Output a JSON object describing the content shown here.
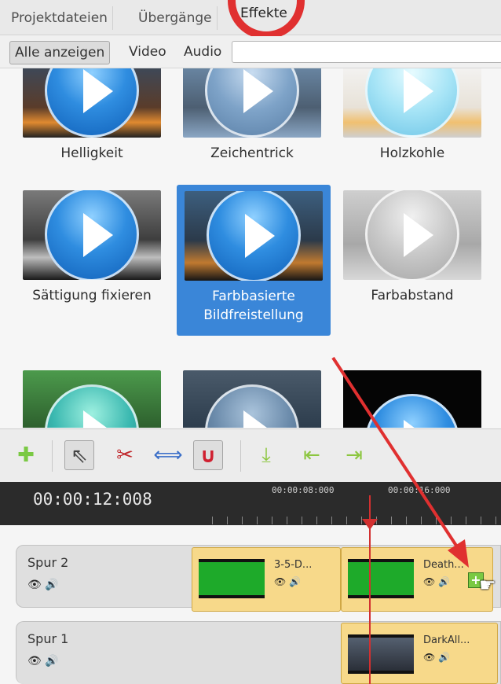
{
  "tabs": {
    "project_files": "Projektdateien",
    "transitions": "Übergänge",
    "effects": "Effekte"
  },
  "filter": {
    "show_all": "Alle anzeigen",
    "video": "Video",
    "audio": "Audio",
    "search_value": ""
  },
  "effects": [
    {
      "label": "Helligkeit"
    },
    {
      "label": "Zeichentrick"
    },
    {
      "label": "Holzkohle"
    },
    {
      "label": "Sättigung fixieren"
    },
    {
      "label": "Farbbasierte Bildfreistellung",
      "selected": true
    },
    {
      "label": "Farbabstand"
    }
  ],
  "toolbar": {
    "icons": [
      "add-track-icon",
      "pointer-icon",
      "razor-icon",
      "stretch-icon",
      "snap-magnet-icon",
      "add-marker-icon",
      "previous-marker-icon",
      "next-marker-icon"
    ]
  },
  "timeline": {
    "current_time": "00:00:12:008",
    "ruler_labels": [
      "00:00:08:000",
      "00:00:16:000"
    ],
    "tracks": [
      {
        "name": "Spur 2",
        "clips": [
          {
            "name": "3-5-D..."
          },
          {
            "name": "Death..."
          }
        ]
      },
      {
        "name": "Spur 1",
        "clips": [
          {
            "name": "DarkAll..."
          }
        ]
      }
    ]
  },
  "colors": {
    "selection": "#3a86d8",
    "clip": "#f7d98a",
    "annotation": "#e03030",
    "ruler_bg": "#2b2b2b"
  }
}
